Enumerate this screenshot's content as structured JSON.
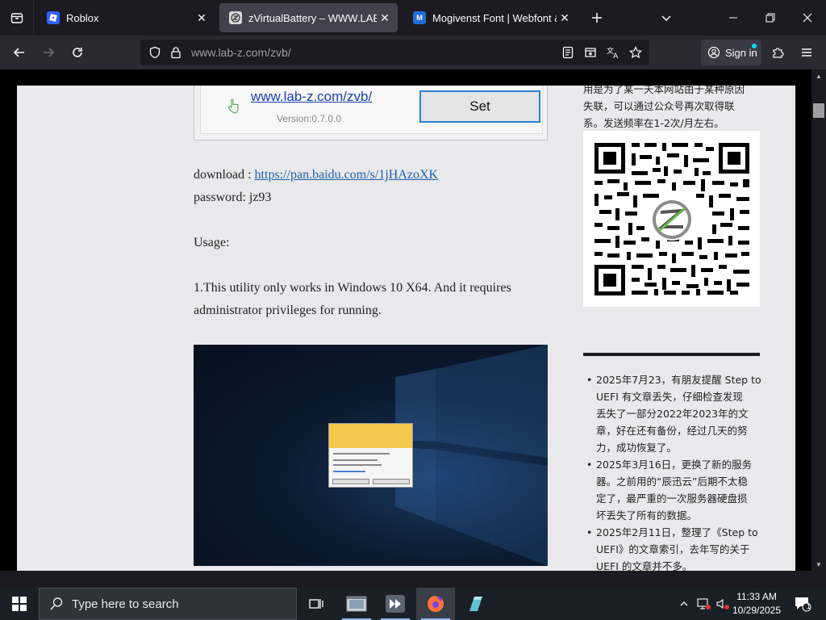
{
  "browser": {
    "tabs": [
      {
        "title": "Roblox",
        "favicon_color": "#335fff",
        "active": false
      },
      {
        "title": "zVirtualBattery – WWW.LAB-Z.C",
        "favicon_color": "#d9d9d9",
        "active": true
      },
      {
        "title": "Mogivenst Font | Webfont & De",
        "favicon_color": "#1f6fd8",
        "active": false
      }
    ],
    "url": {
      "host": "www.lab-z.com",
      "path": "/zvb/"
    },
    "signin_label": "Sign in"
  },
  "article": {
    "screenshot": {
      "link": "www.lab-z.com/zvb/",
      "version": "Version:0.7.0.0",
      "set_button": "Set"
    },
    "download_label": "download : ",
    "download_link": "https://pan.baidu.com/s/1jHAzoXK",
    "password": "password: jz93",
    "usage": "Usage:",
    "step1_line1": "1.This utility only works in Windows 10 X64. And it requires",
    "step1_line2": "administrator privileges for running."
  },
  "sidebar": {
    "intro_lines": [
      "用是为了某一天本网站由于某种原因",
      "失联，可以通过公众号再次取得联",
      "系。发送频率在1-2次/月左右。"
    ],
    "news": [
      {
        "lines": [
          "2025年7月23，有朋友提醒 Step to",
          "UEFI 有文章丢失，仔细检查发现",
          "丢失了一部分2022年2023年的文",
          "章，好在还有备份，经过几天的努",
          "力，成功恢复了。"
        ]
      },
      {
        "lines": [
          "2025年3月16日，更换了新的服务",
          "器。之前用的“辰迅云”后期不太稳",
          "定了，最严重的一次服务器硬盘损",
          "坏丢失了所有的数据。"
        ]
      },
      {
        "lines": [
          "2025年2月11日，整理了《Step to",
          "UEFI》的文章索引，去年写的关于",
          "UEFI 的文章并不多。"
        ]
      }
    ]
  },
  "taskbar": {
    "search_placeholder": "Type here to search",
    "time": "11:33 AM",
    "date": "10/29/2025",
    "notification_count": "1"
  },
  "colors": {
    "accent": "#0df",
    "link": "#1a5fa8",
    "page_bg": "#e9e9ec"
  }
}
